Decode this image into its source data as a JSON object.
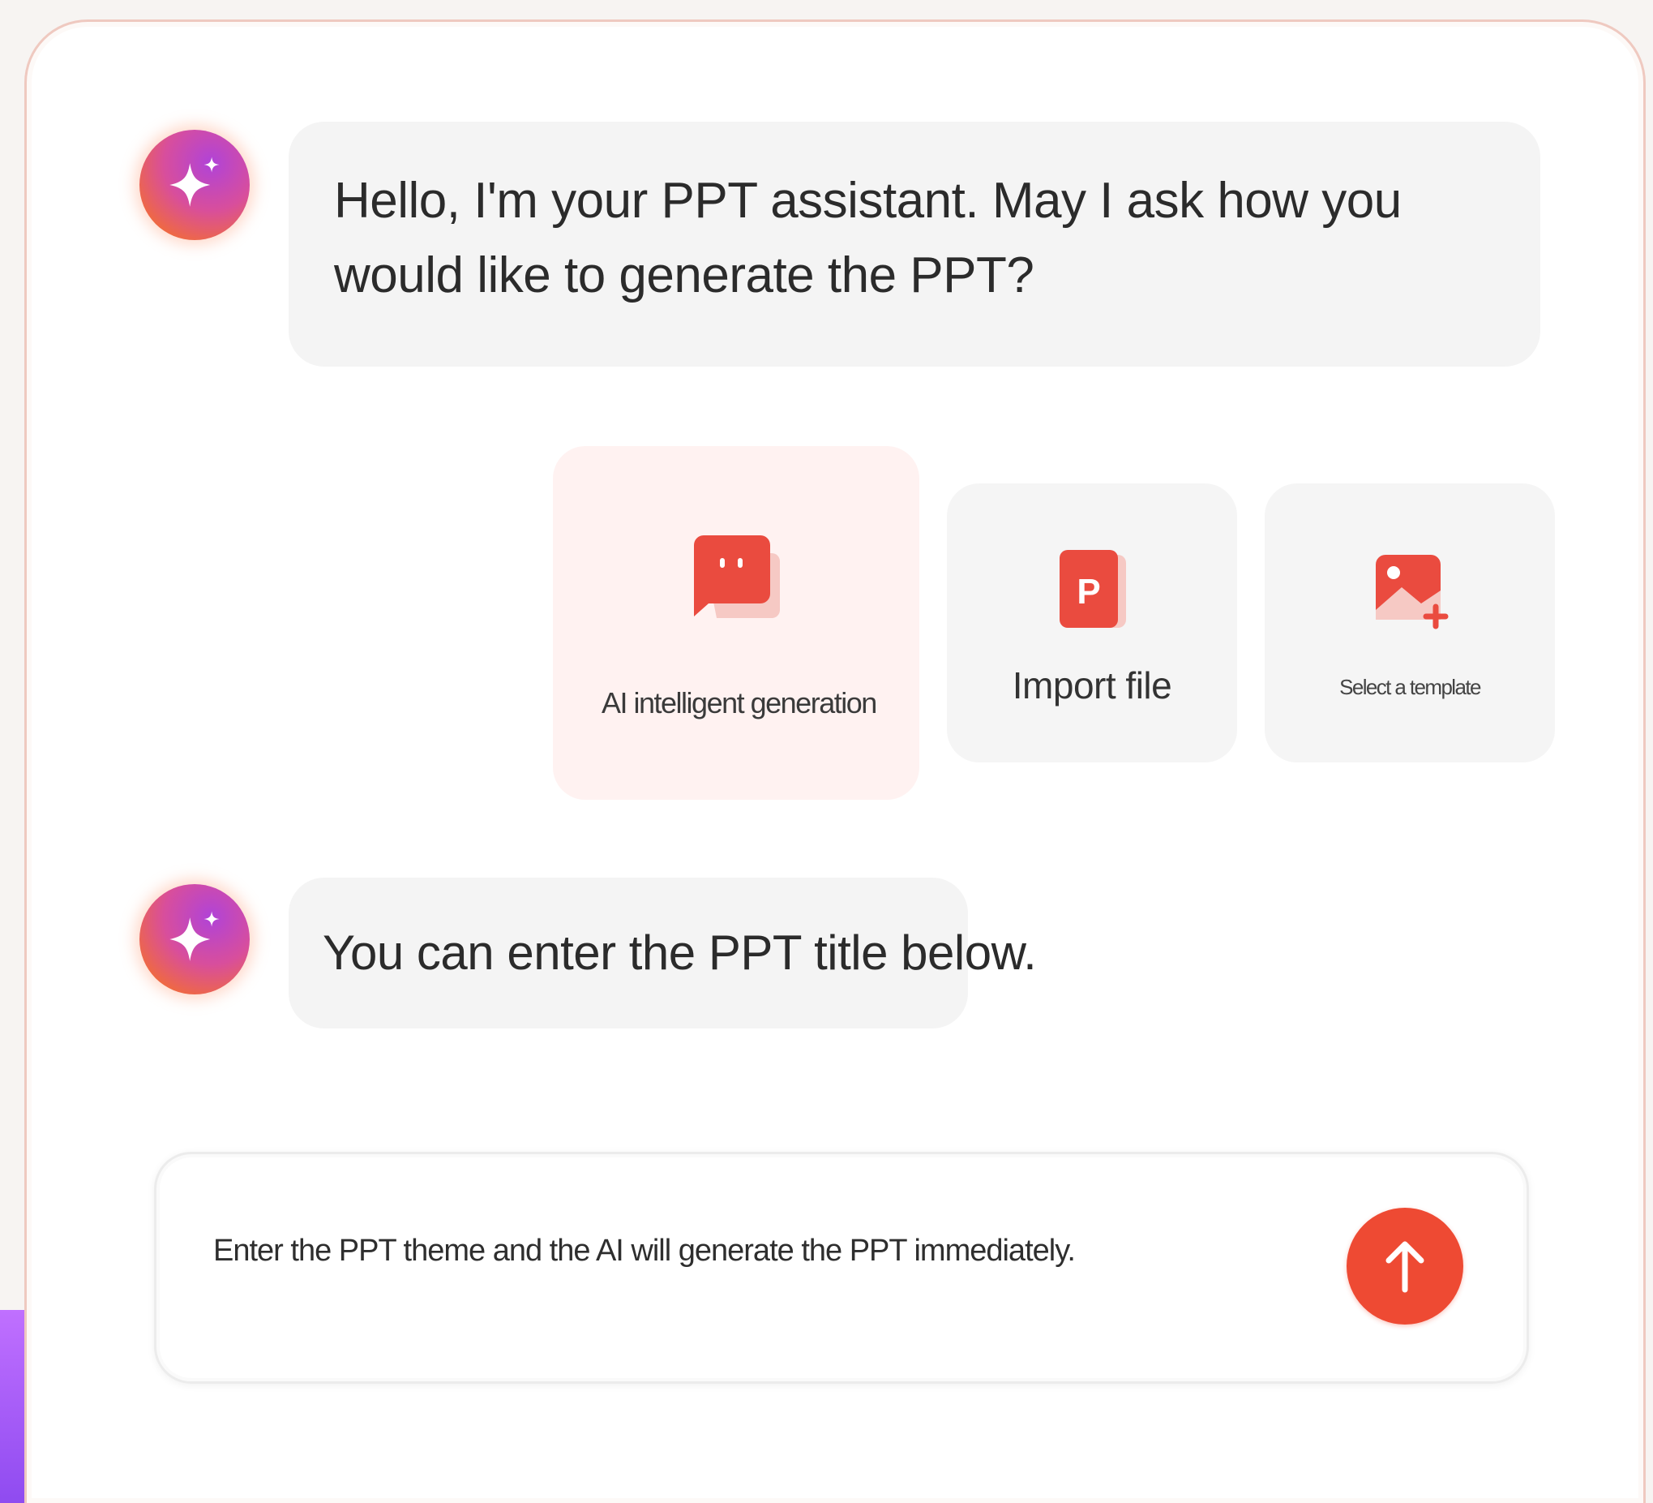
{
  "chat": {
    "messages": [
      {
        "role": "assistant",
        "text": "Hello, I'm your PPT assistant. May I ask how you would like to generate the PPT?",
        "avatar_icon": "sparkle-icon"
      },
      {
        "role": "assistant",
        "text": "You can enter the PPT title below.",
        "avatar_icon": "sparkle-icon"
      }
    ],
    "options": [
      {
        "label": "AI intelligent generation",
        "icon": "chat-bubble-icon",
        "selected": true
      },
      {
        "label": "Import file",
        "icon": "ppt-file-icon",
        "selected": false
      },
      {
        "label": "Select a template",
        "icon": "image-template-icon",
        "selected": false
      }
    ]
  },
  "input": {
    "placeholder": "Enter the PPT theme and the AI will generate the PPT immediately.",
    "value": "",
    "send_icon": "arrow-up-icon"
  },
  "colors": {
    "accent": "#ee4a33",
    "icon_red": "#ea4b3f",
    "selected_option_bg": "#fff2f1",
    "bubble_bg": "#f4f4f4",
    "avatar_gradient": [
      "#b043d8",
      "#d84e9c",
      "#f06a3e"
    ],
    "side_strip": "#b060ff"
  }
}
